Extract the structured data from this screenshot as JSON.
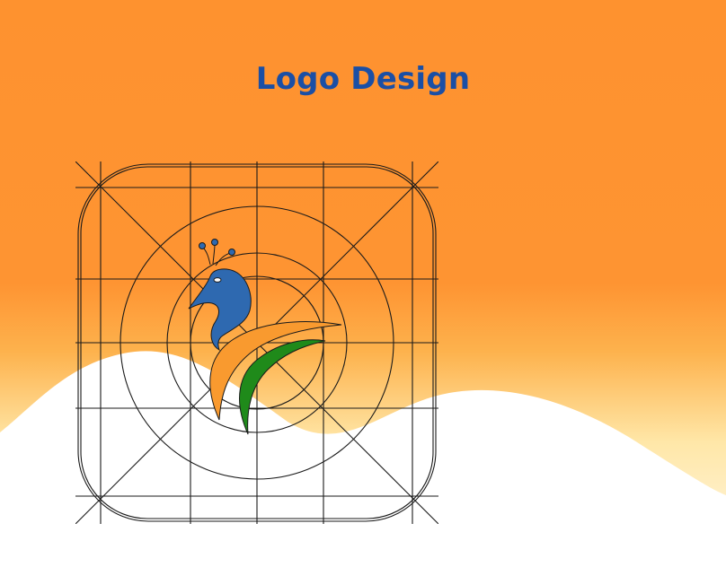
{
  "title": "Logo Design",
  "colors": {
    "background_orange": "#fe9432",
    "title_blue": "#1b4fa5",
    "peacock_blue": "#2e69b0",
    "peacock_orange": "#f99a2f",
    "peacock_green": "#1f8a1a",
    "grid_line": "#1a1a1a",
    "wave_white": "#ffffff"
  },
  "icons": {
    "logo": "peacock-logo-icon",
    "construction_grid": "app-icon-construction-grid"
  }
}
